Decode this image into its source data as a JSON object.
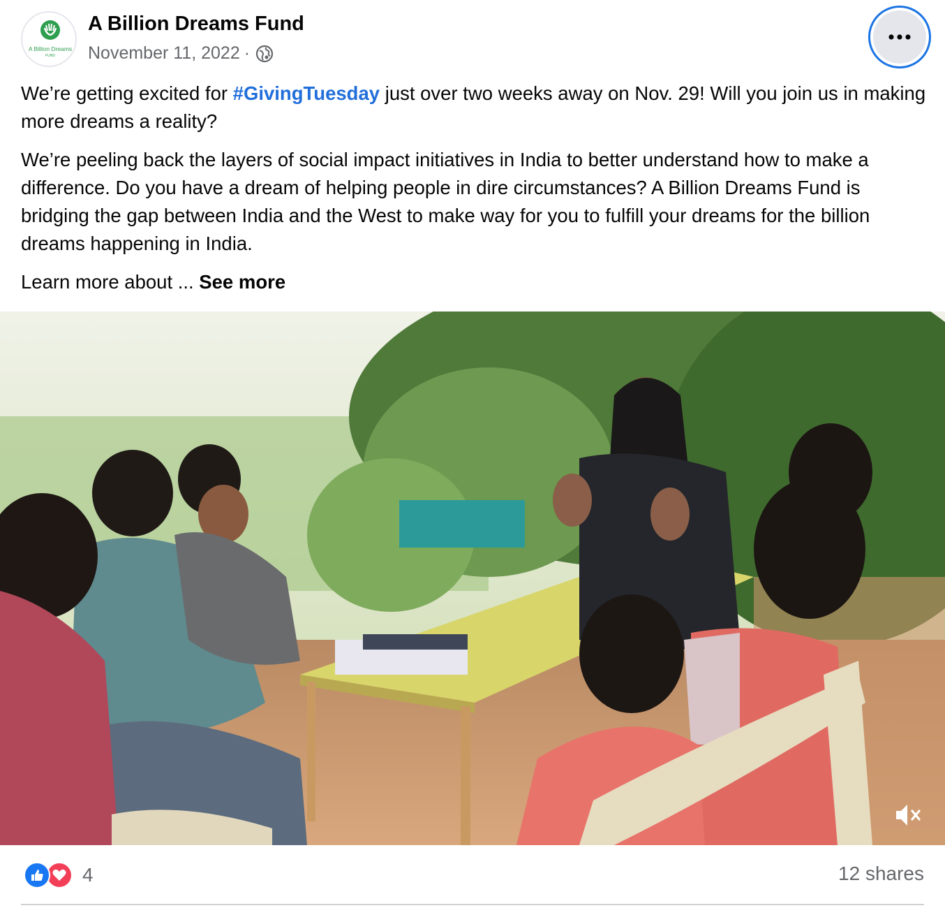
{
  "post": {
    "page_name": "A Billion Dreams Fund",
    "date": "November 11, 2022",
    "separator": "·",
    "privacy_icon": "globe-icon",
    "more_icon": "more-options-icon",
    "avatar_logo_text": "A Billion Dreams",
    "avatar_logo_subtext": "FUND",
    "body": {
      "p1_before": "We’re getting excited for ",
      "hashtag": "#GivingTuesday",
      "p1_after": " just over two weeks away on Nov. 29! Will you join us in making more dreams a reality?",
      "p2": "We’re peeling back the layers of social impact initiatives in India to better understand how to make a difference. Do you have a dream of helping people in dire circumstances? A Billion Dreams Fund is bridging the gap between India and the West to make way for you to fulfill your dreams for the billion dreams happening in India.",
      "p3": "Learn more about ... ",
      "see_more": "See more"
    },
    "media": {
      "type": "video",
      "mute_icon": "muted-speaker-icon"
    },
    "footer": {
      "reaction_icons": [
        "like-reaction-icon",
        "love-reaction-icon"
      ],
      "reaction_count": "4",
      "shares": "12 shares"
    }
  },
  "colors": {
    "hashtag": "#216fdb",
    "like": "#1877f2",
    "love": "#f33e58",
    "focus_ring": "#1b74e4",
    "meta_text": "#65676b",
    "logo_green": "#2e9e4f"
  }
}
